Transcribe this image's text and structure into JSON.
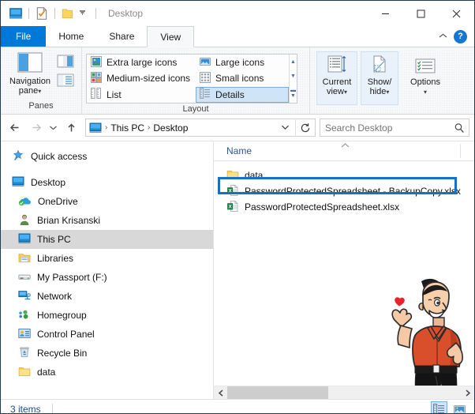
{
  "window": {
    "title": "Desktop",
    "quick_access": [
      "this-pc-icon",
      "properties-icon",
      "new-folder-icon",
      "customize-caret-icon"
    ],
    "controls": {
      "minimize": "minimize-icon",
      "maximize": "maximize-icon",
      "close": "close-icon"
    }
  },
  "tabs": [
    {
      "id": "file",
      "label": "File"
    },
    {
      "id": "home",
      "label": "Home"
    },
    {
      "id": "share",
      "label": "Share"
    },
    {
      "id": "view",
      "label": "View"
    }
  ],
  "tabstrip_right": {
    "collapse_label": "^",
    "help_label": "?"
  },
  "ribbon": {
    "groups": [
      {
        "id": "panes",
        "label": "Panes"
      },
      {
        "id": "layout",
        "label": "Layout"
      },
      {
        "id": "currentview",
        "label": "Current view"
      },
      {
        "id": "showhide",
        "label": "Show/ hide"
      },
      {
        "id": "options",
        "label": "Options"
      }
    ],
    "panes": {
      "navigation_pane_label": "Navigation\npane",
      "navigation_pane_line1": "Navigation",
      "navigation_pane_line2": "pane",
      "caret": "▾"
    },
    "layout": {
      "items": [
        {
          "id": "extra-large-icons",
          "label": "Extra large icons",
          "selected": false
        },
        {
          "id": "large-icons",
          "label": "Large icons",
          "selected": false
        },
        {
          "id": "medium-sized-icons",
          "label": "Medium-sized icons",
          "selected": false
        },
        {
          "id": "small-icons",
          "label": "Small icons",
          "selected": false
        },
        {
          "id": "list",
          "label": "List",
          "selected": false
        },
        {
          "id": "details",
          "label": "Details",
          "selected": true
        }
      ]
    },
    "current_view": {
      "line1": "Current",
      "line2": "view",
      "caret": "▾"
    },
    "show_hide": {
      "line1": "Show/",
      "line2": "hide",
      "caret": "▾"
    },
    "options": {
      "line1": "Options",
      "caret": "▾"
    }
  },
  "address": {
    "back_icon": "back-arrow-icon",
    "forward_icon": "forward-arrow-icon",
    "recent_icon": "recent-locations-icon",
    "up_icon": "up-arrow-icon",
    "breadcrumbs": [
      "This PC",
      "Desktop"
    ],
    "separator": "›",
    "dropdown_caret": "⌄",
    "refresh_icon": "refresh-icon"
  },
  "search": {
    "placeholder": "Search Desktop",
    "value": "",
    "icon": "search-icon"
  },
  "sidebar": {
    "items": [
      {
        "id": "quick-access",
        "label": "Quick access",
        "icon": "star-pin-icon",
        "indent": false,
        "selected": false,
        "spacer_after": true
      },
      {
        "id": "desktop",
        "label": "Desktop",
        "icon": "desktop-monitor-icon",
        "indent": false,
        "selected": false
      },
      {
        "id": "onedrive",
        "label": "OneDrive",
        "icon": "onedrive-cloud-icon",
        "indent": true,
        "selected": false
      },
      {
        "id": "brian-krisanski",
        "label": "Brian Krisanski",
        "icon": "user-icon",
        "indent": true,
        "selected": false
      },
      {
        "id": "this-pc",
        "label": "This PC",
        "icon": "this-pc-icon",
        "indent": true,
        "selected": true
      },
      {
        "id": "libraries",
        "label": "Libraries",
        "icon": "libraries-folder-icon",
        "indent": true,
        "selected": false
      },
      {
        "id": "my-passport-f",
        "label": "My Passport (F:)",
        "icon": "external-drive-icon",
        "indent": true,
        "selected": false
      },
      {
        "id": "network",
        "label": "Network",
        "icon": "network-icon",
        "indent": true,
        "selected": false
      },
      {
        "id": "homegroup",
        "label": "Homegroup",
        "icon": "homegroup-icon",
        "indent": true,
        "selected": false
      },
      {
        "id": "control-panel",
        "label": "Control Panel",
        "icon": "control-panel-icon",
        "indent": true,
        "selected": false
      },
      {
        "id": "recycle-bin",
        "label": "Recycle Bin",
        "icon": "recycle-bin-icon",
        "indent": true,
        "selected": false
      },
      {
        "id": "data",
        "label": "data",
        "icon": "folder-icon",
        "indent": true,
        "selected": false
      }
    ]
  },
  "filelist": {
    "columns": [
      {
        "id": "name",
        "label": "Name",
        "sort": "ascending",
        "sort_glyph": "^"
      }
    ],
    "rows": [
      {
        "id": "folder-data",
        "name": "data",
        "icon": "folder-icon",
        "highlighted": false
      },
      {
        "id": "backupcopy-xlsx",
        "name": "PasswordProtectedSpreadsheet - BackupCopy.xlsx",
        "icon": "excel-file-icon",
        "highlighted": true
      },
      {
        "id": "original-xlsx",
        "name": "PasswordProtectedSpreadsheet.xlsx",
        "icon": "excel-file-icon",
        "highlighted": false
      }
    ]
  },
  "annotation": {
    "target": "backupcopy-xlsx",
    "color": "#1a6fc4"
  },
  "hscrollbar": {
    "left_arrow": "‹",
    "right_arrow": "›"
  },
  "statusbar": {
    "item_count": "3 items",
    "view_buttons": [
      {
        "id": "details-view",
        "icon": "details-view-icon",
        "selected": true
      },
      {
        "id": "large-icons-view",
        "icon": "large-icons-view-icon",
        "selected": false
      }
    ]
  },
  "mascot": {
    "name": "cartoon-man-holding-heart"
  }
}
